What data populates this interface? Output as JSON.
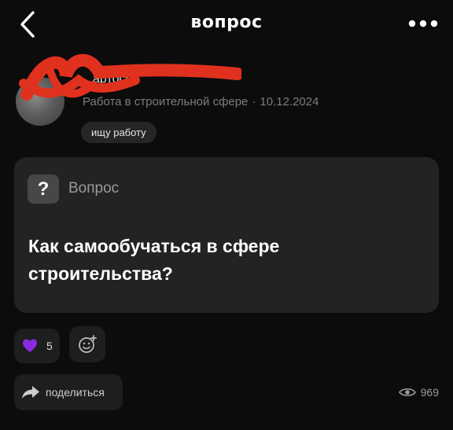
{
  "header": {
    "back_icon": "chevron-left-icon",
    "title": "вопрос",
    "more_icon": "more-horizontal-icon"
  },
  "post": {
    "author_partial": "артосов",
    "author_redacted": true,
    "workplace": "Работа в строительной сфере",
    "separator": "·",
    "date": "10.12.2024",
    "status_tag": "ищу работу",
    "question_label": "Вопрос",
    "question_icon_glyph": "?",
    "question_text": "Как самообучаться в сфере строительства?"
  },
  "actions": {
    "reaction_icon": "purple-heart-icon",
    "reaction_count": "5",
    "add_reaction_icon": "add-reaction-icon",
    "share_label": "поделиться",
    "share_icon": "share-arrow-icon",
    "views_icon": "eye-icon",
    "views_count": "969"
  },
  "colors": {
    "background": "#0c0c0c",
    "card": "#232323",
    "heart": "#8a2be2",
    "redaction": "#e0311f"
  }
}
